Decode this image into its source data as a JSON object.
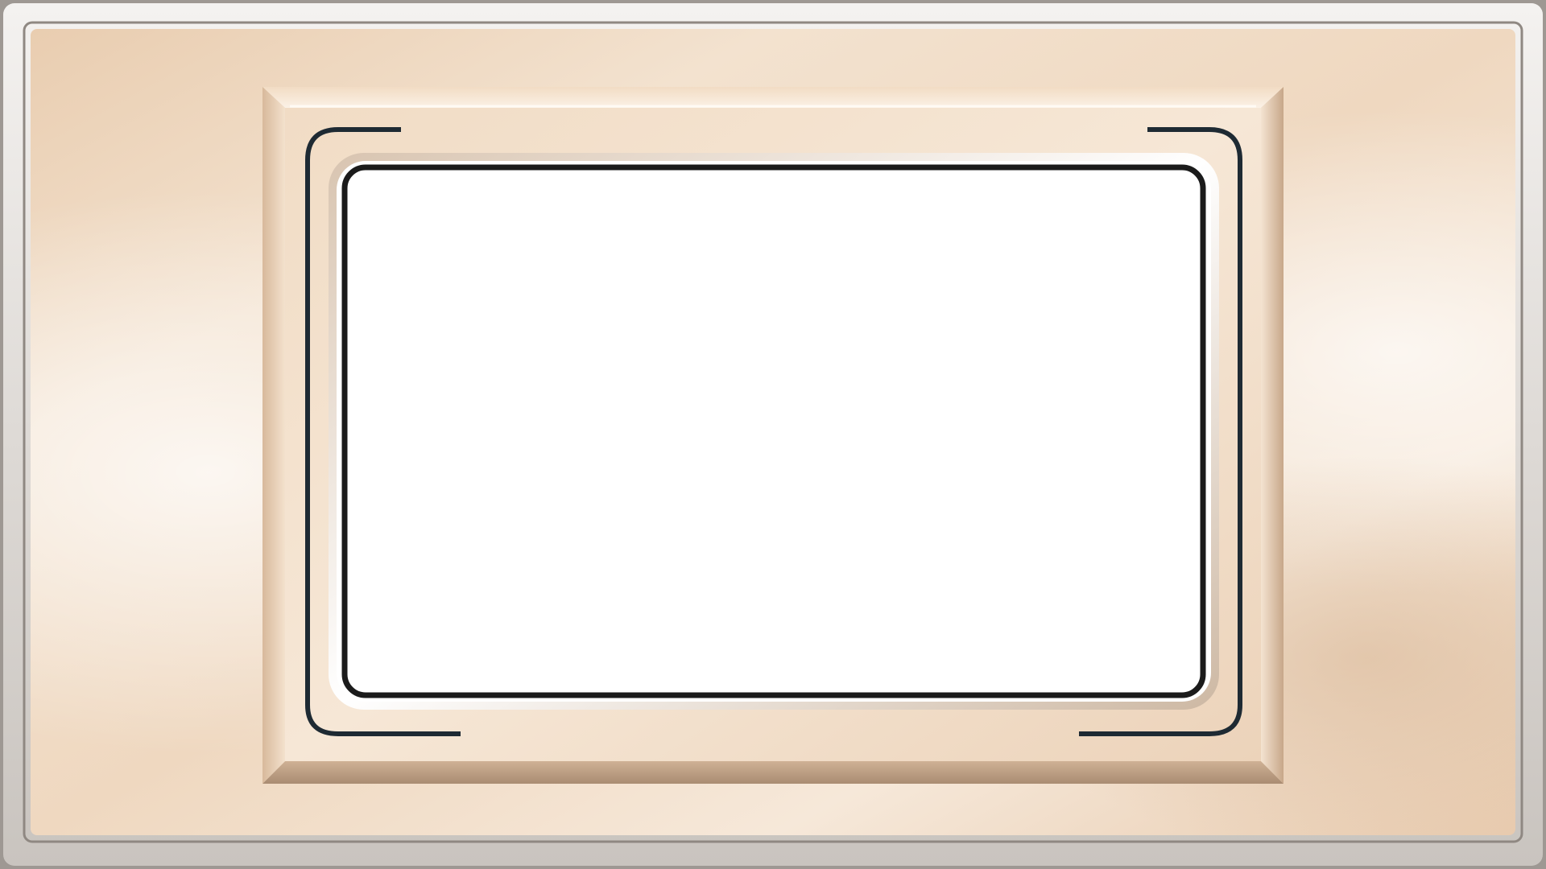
{
  "frame": {
    "style": "beige-watercolor-bevel-frame",
    "colors": {
      "outer_rim": "#e9e6e3",
      "outer_rim_shadow": "#a9a29c",
      "background_light": "#f7ecdf",
      "background_mid": "#ecd6bd",
      "background_warm": "#e4c6a6",
      "bevel_highlight": "#f8ecdd",
      "bevel_shadow": "#b59a80",
      "bevel_side_dark": "#caa98a",
      "inner_panel": "#f1dcc5",
      "bracket_stroke": "#1e2a33",
      "window_border": "#1b1b1b",
      "window_ring": "#ffffff",
      "window_fill": "#ffffff"
    }
  }
}
